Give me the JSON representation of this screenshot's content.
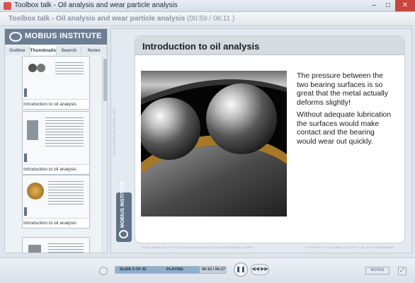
{
  "window": {
    "title": "Toolbox talk - Oil analysis and wear particle analysis",
    "minimize": "–",
    "maximize": "□",
    "close": "✕"
  },
  "header": {
    "course_title": "Toolbox talk - Oil analysis and wear particle analysis",
    "elapsed": "(00:59 / 08:11 )"
  },
  "brand": {
    "logo_text": "MOBIUS INSTITUTE",
    "badge_text": "MOBIUS INSTITUTE"
  },
  "tabs": [
    "Outline",
    "Thumbnails",
    "Search",
    "Notes"
  ],
  "active_tab": "Thumbnails",
  "thumbnails": [
    {
      "caption": "Introduction to oil analysis"
    },
    {
      "caption": "Introduction to oil analysis"
    },
    {
      "caption": "Introduction to oil analysis"
    },
    {
      "caption": ""
    }
  ],
  "slide": {
    "title": "Introduction to oil analysis",
    "paragraphs": [
      "The pressure between the two bearing surfaces is so great that the metal actually deforms slightly!",
      "Without adequate lubrication the surfaces would make contact and the bearing would wear out quickly."
    ],
    "watermark": "www.mobiusinstitute.com",
    "footer_left": "THESE SLIDES ARE NOT TO BE USED IN AN INSTRUCTOR LED TRAINING COURSE",
    "footer_right": "COPYRIGHT © 2015 MOBIUS INSTITUTE - ALL RIGHTS RESERVED"
  },
  "player": {
    "slide_position": "SLIDE 5 OF 32",
    "status": "PLAYING",
    "time": "00:13 / 00:17",
    "progress": 0.76,
    "skip_label": "◀◀ ▶▶",
    "play_label": "❚❚",
    "notes_label": "NOTES",
    "resize_label": "⤢"
  },
  "colors": {
    "accent": "#5f7288",
    "progress_fill": "#8faecb",
    "close_button": "#c9463d"
  }
}
